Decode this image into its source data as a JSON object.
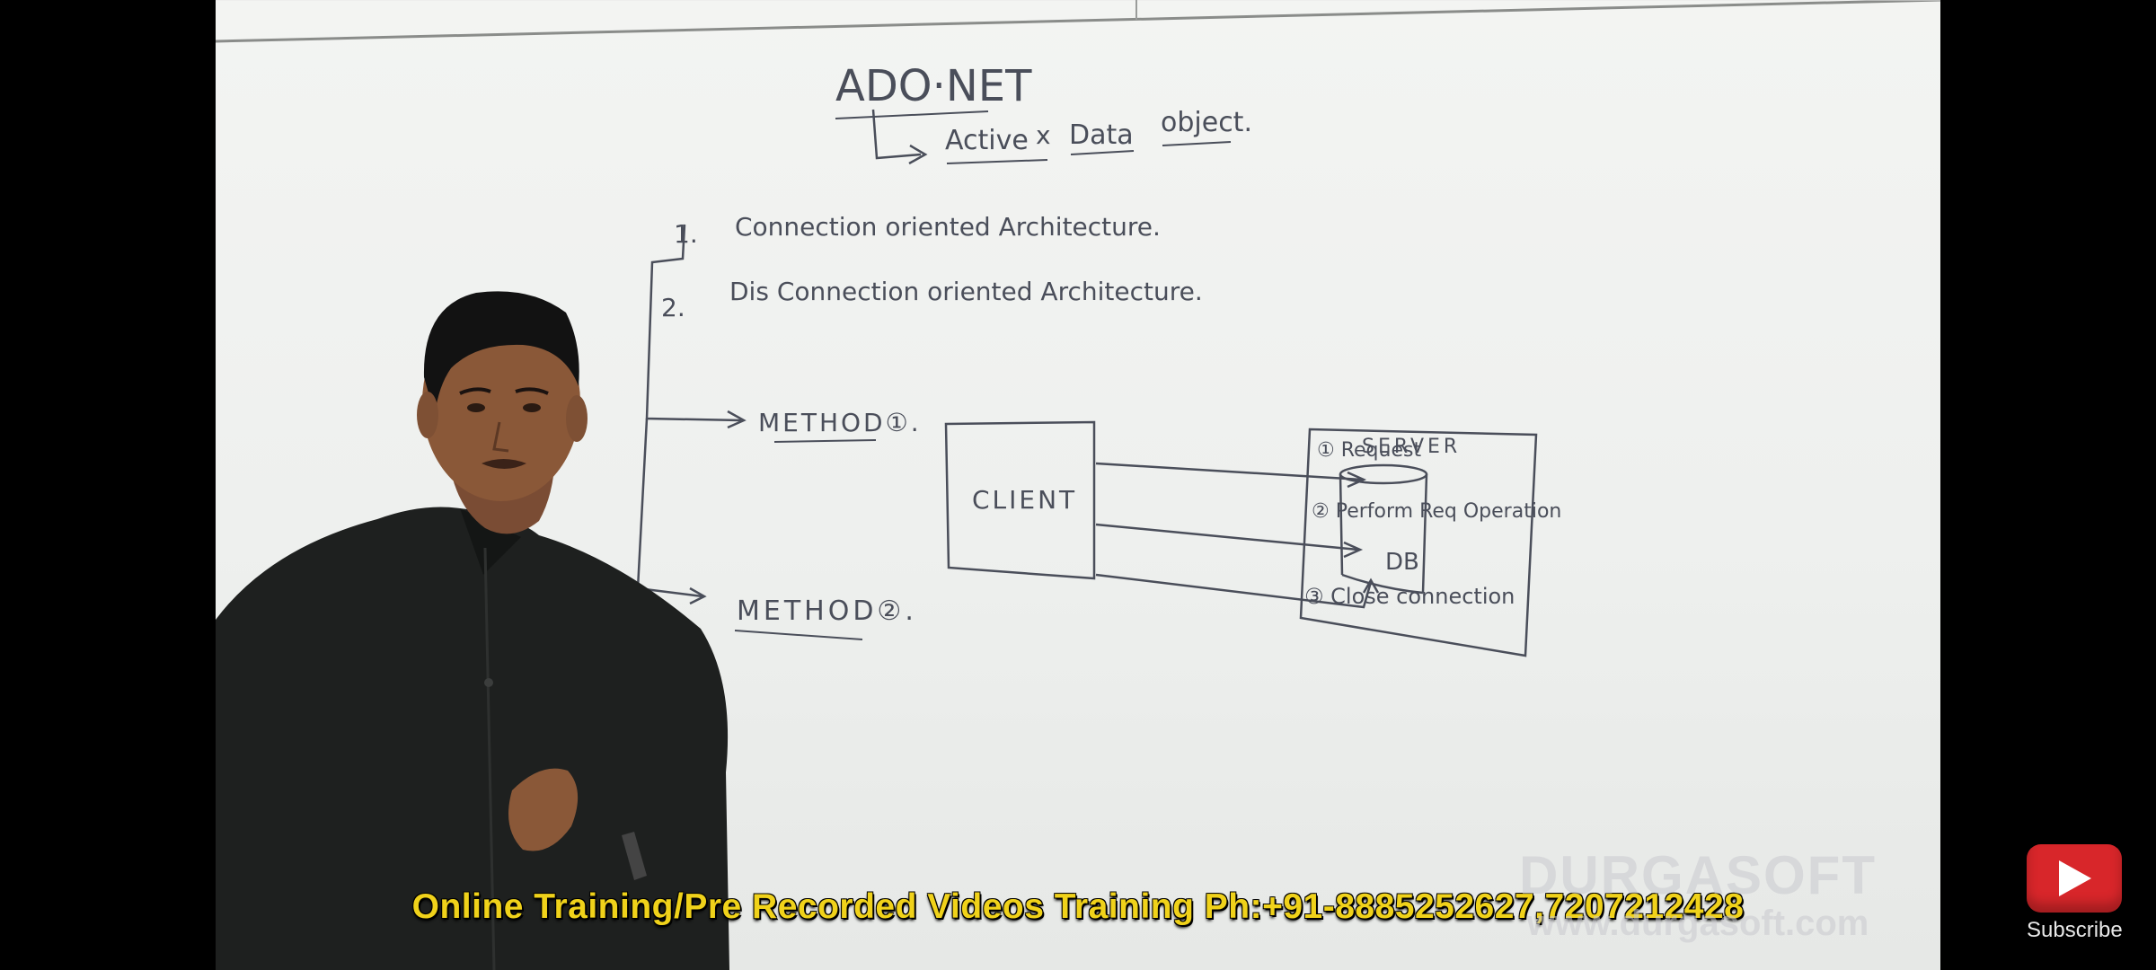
{
  "board": {
    "title": "ADO·NET",
    "expansion": [
      "Active",
      "x",
      "Data",
      "object."
    ],
    "list": [
      {
        "num": "1.",
        "text": "Connection oriented Architecture."
      },
      {
        "num": "2.",
        "text": "Dis Connection oriented Architecture."
      }
    ],
    "method1": "METHOD①.",
    "method2": "METHOD②.",
    "client": "CLIENT",
    "server": "SERVER",
    "db": "DB",
    "steps": [
      "① Request",
      "② Perform Req Operation",
      "③ Close connection"
    ]
  },
  "caption": "Online Training/Pre Recorded Videos Training Ph:+91-8885252627,7207212428",
  "watermark": {
    "name": "DURGASOFT",
    "url": "www.durgasoft.com"
  },
  "subscribe": {
    "label": "Subscribe",
    "icon": "play-icon",
    "color": "#d8262a"
  },
  "colors": {
    "marker": "#4a4e5a",
    "caption": "#f0d21a"
  }
}
